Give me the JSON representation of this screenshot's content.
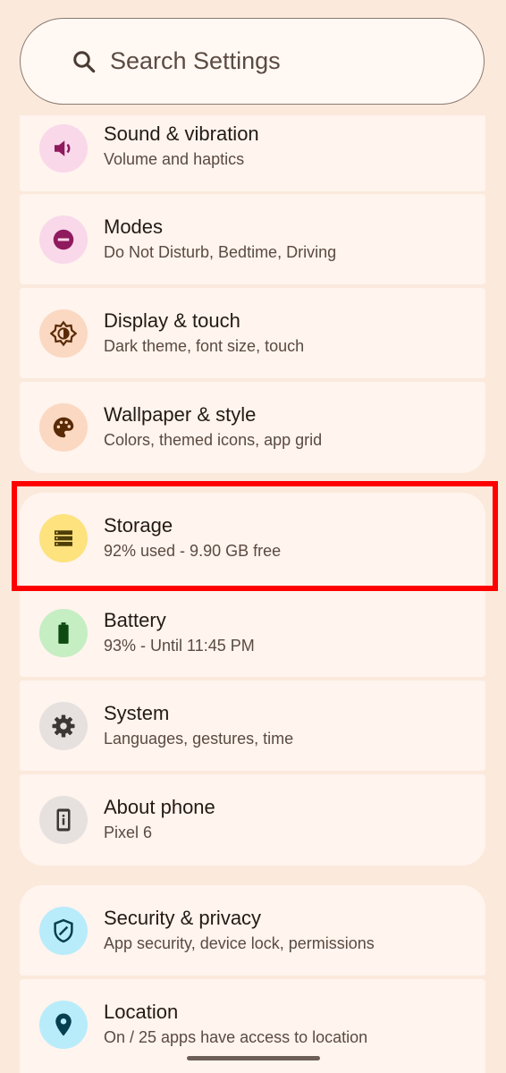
{
  "search": {
    "placeholder": "Search Settings",
    "icon": "search-icon"
  },
  "items": [
    {
      "id": "sound",
      "title": "Sound & vibration",
      "subtitle": "Volume and haptics",
      "icon": "volume-icon",
      "badge_color": "#f9d8ea",
      "icon_color": "#8f1a5d"
    },
    {
      "id": "modes",
      "title": "Modes",
      "subtitle": "Do Not Disturb, Bedtime, Driving",
      "icon": "do-not-disturb-icon",
      "badge_color": "#f9d8ea",
      "icon_color": "#8f1a5d"
    },
    {
      "id": "display",
      "title": "Display & touch",
      "subtitle": "Dark theme, font size, touch",
      "icon": "brightness-icon",
      "badge_color": "#fbd8c2",
      "icon_color": "#5a2a05"
    },
    {
      "id": "wallpaper",
      "title": "Wallpaper & style",
      "subtitle": "Colors, themed icons, app grid",
      "icon": "palette-icon",
      "badge_color": "#fbd8c2",
      "icon_color": "#5a2a05"
    },
    {
      "id": "storage",
      "title": "Storage",
      "subtitle": "92% used - 9.90 GB free",
      "icon": "storage-icon",
      "badge_color": "#fde27e",
      "icon_color": "#4e3f08"
    },
    {
      "id": "battery",
      "title": "Battery",
      "subtitle": "93% - Until 11:45 PM",
      "icon": "battery-icon",
      "badge_color": "#c5eec3",
      "icon_color": "#0e4a12"
    },
    {
      "id": "system",
      "title": "System",
      "subtitle": "Languages, gestures, time",
      "icon": "gear-icon",
      "badge_color": "#e6e1df",
      "icon_color": "#3c3634"
    },
    {
      "id": "about",
      "title": "About phone",
      "subtitle": "Pixel 6",
      "icon": "phone-info-icon",
      "badge_color": "#e6e1df",
      "icon_color": "#3c3634"
    },
    {
      "id": "security",
      "title": "Security & privacy",
      "subtitle": "App security, device lock, permissions",
      "icon": "shield-icon",
      "badge_color": "#b8ecfb",
      "icon_color": "#063f50"
    },
    {
      "id": "location",
      "title": "Location",
      "subtitle": "On / 25 apps have access to location",
      "icon": "location-pin-icon",
      "badge_color": "#b8ecfb",
      "icon_color": "#063f50"
    }
  ]
}
